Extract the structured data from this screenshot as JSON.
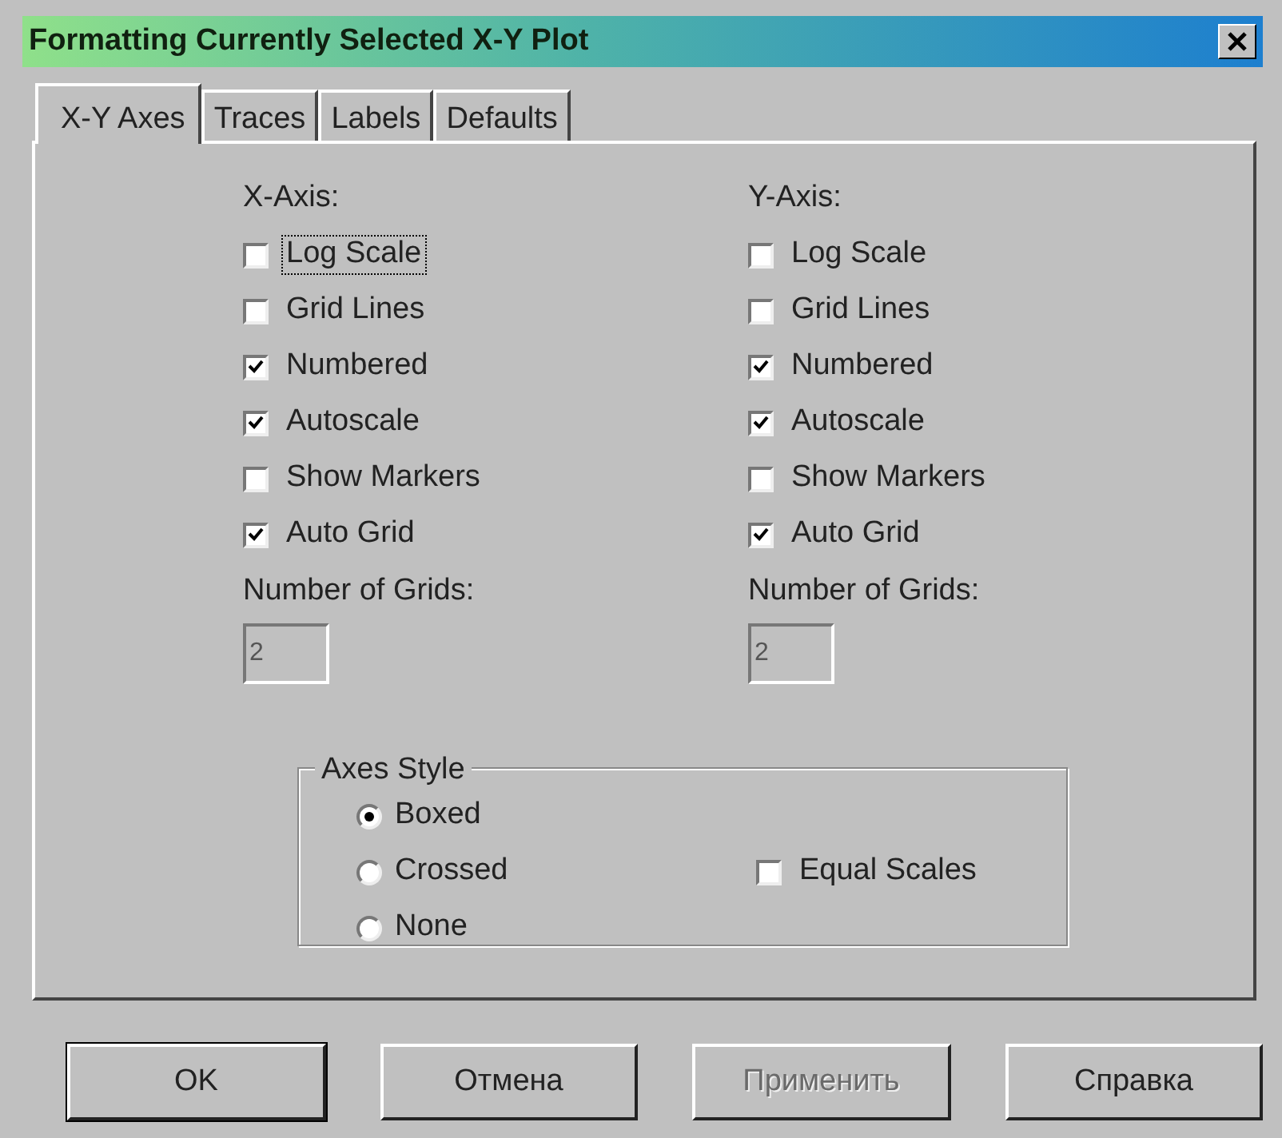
{
  "window": {
    "title": "Formatting Currently Selected X-Y Plot"
  },
  "tabs": [
    {
      "label": "X-Y Axes",
      "selected": true
    },
    {
      "label": "Traces",
      "selected": false
    },
    {
      "label": "Labels",
      "selected": false
    },
    {
      "label": "Defaults",
      "selected": false
    }
  ],
  "axes": [
    {
      "heading": "X-Axis:",
      "options": [
        {
          "label": "Log Scale",
          "checked": false,
          "focused": true
        },
        {
          "label": "Grid Lines",
          "checked": false,
          "focused": false
        },
        {
          "label": "Numbered",
          "checked": true,
          "focused": false
        },
        {
          "label": "Autoscale",
          "checked": true,
          "focused": false
        },
        {
          "label": "Show Markers",
          "checked": false,
          "focused": false
        },
        {
          "label": "Auto Grid",
          "checked": true,
          "focused": false
        }
      ],
      "grids_label": "Number of Grids:",
      "grids_value": "2",
      "grids_disabled": true
    },
    {
      "heading": "Y-Axis:",
      "options": [
        {
          "label": "Log Scale",
          "checked": false,
          "focused": false
        },
        {
          "label": "Grid Lines",
          "checked": false,
          "focused": false
        },
        {
          "label": "Numbered",
          "checked": true,
          "focused": false
        },
        {
          "label": "Autoscale",
          "checked": true,
          "focused": false
        },
        {
          "label": "Show Markers",
          "checked": false,
          "focused": false
        },
        {
          "label": "Auto Grid",
          "checked": true,
          "focused": false
        }
      ],
      "grids_label": "Number of Grids:",
      "grids_value": "2",
      "grids_disabled": true
    }
  ],
  "axes_style": {
    "title": "Axes Style",
    "options": [
      {
        "label": "Boxed",
        "selected": true
      },
      {
        "label": "Crossed",
        "selected": false
      },
      {
        "label": "None",
        "selected": false
      }
    ],
    "equal_scales": {
      "label": "Equal Scales",
      "checked": false
    }
  },
  "buttons": [
    {
      "label": "OK",
      "disabled": false
    },
    {
      "label": "Отмена",
      "disabled": false
    },
    {
      "label": "Применить",
      "disabled": true
    },
    {
      "label": "Справка",
      "disabled": false
    }
  ]
}
